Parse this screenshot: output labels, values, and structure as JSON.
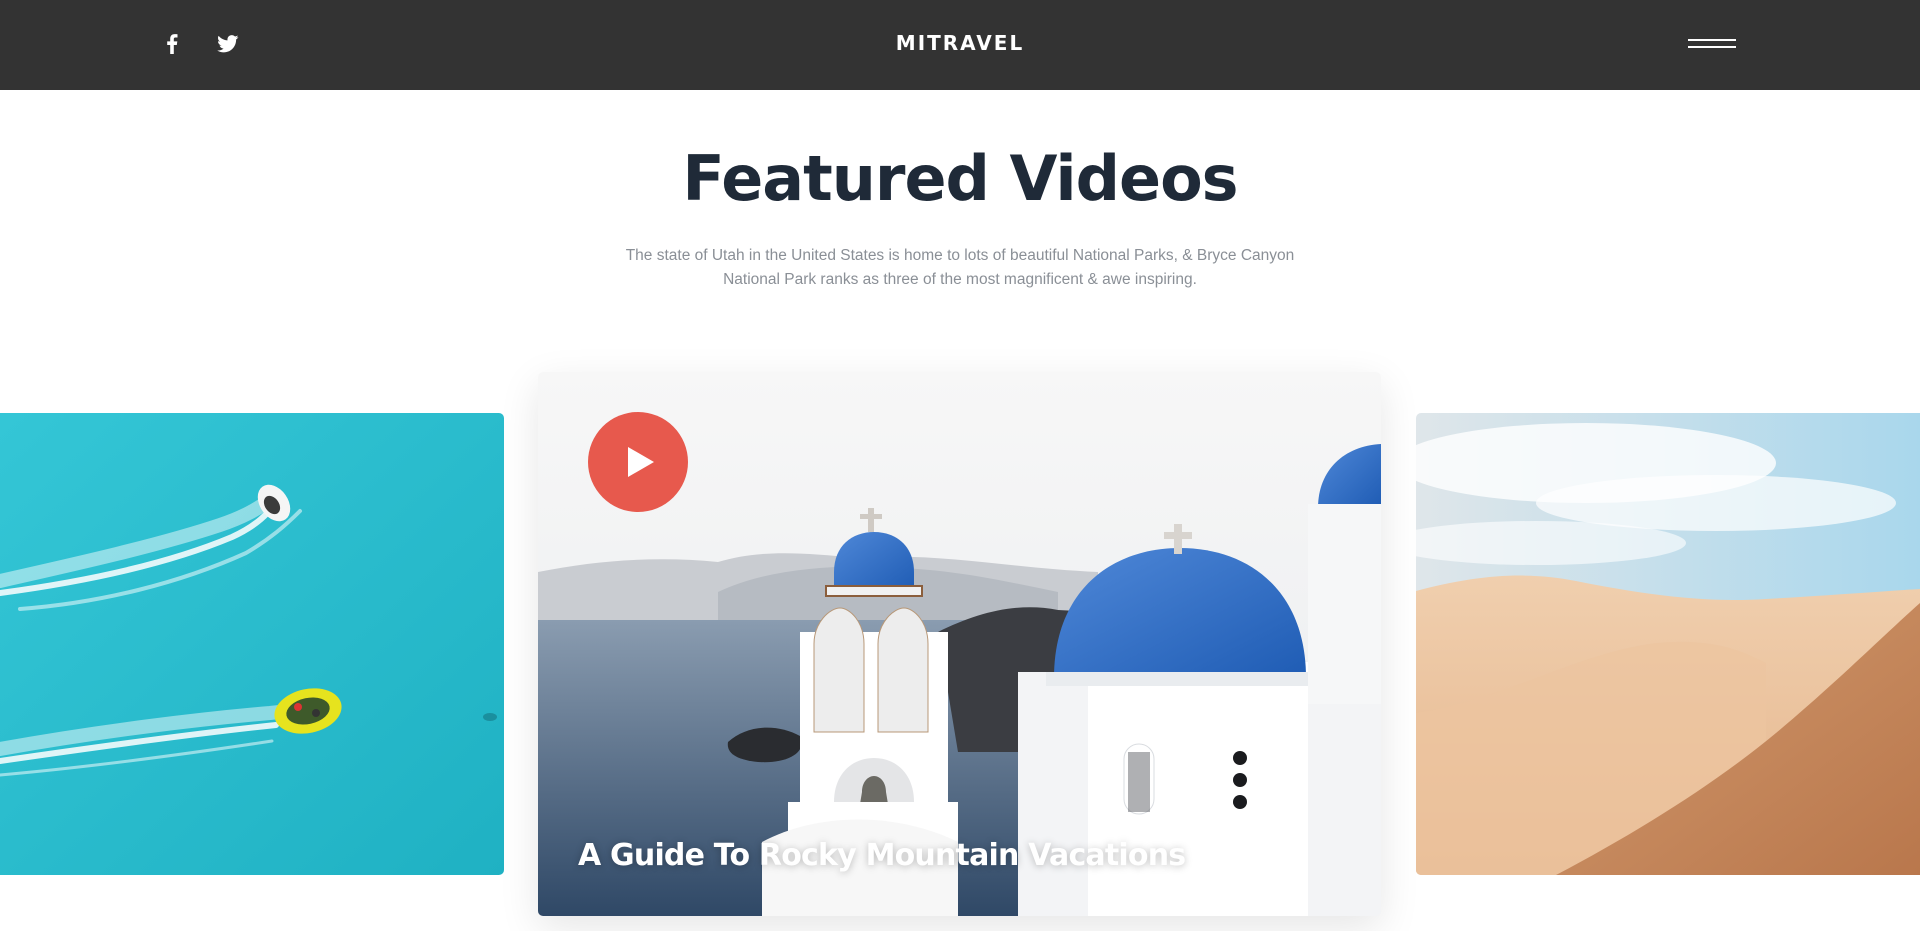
{
  "header": {
    "brand": "MITRAVEL",
    "social": [
      {
        "icon": "facebook-icon"
      },
      {
        "icon": "twitter-icon"
      }
    ],
    "menu_icon": "hamburger-menu-icon"
  },
  "section": {
    "title": "Featured Videos",
    "subtitle": "The state of Utah in the United States is home to lots of beautiful National Parks, & Bryce Canyon National Park ranks as three of the most magnificent & awe inspiring."
  },
  "videos": {
    "left": {
      "scene": "boats on turquoise sea"
    },
    "featured": {
      "caption": "A Guide To Rocky Mountain Vacations",
      "scene": "white church with blue domes by the sea",
      "play_icon": "play-icon"
    },
    "right": {
      "scene": "desert sand dunes"
    }
  },
  "colors": {
    "header_bg": "#333333",
    "title": "#1f2a38",
    "subtitle": "#8a8f96",
    "play_button": "#e7594d",
    "sea": "#2ec3d1",
    "dome_blue": "#2f6fc6",
    "sand": "#d9a27a"
  }
}
